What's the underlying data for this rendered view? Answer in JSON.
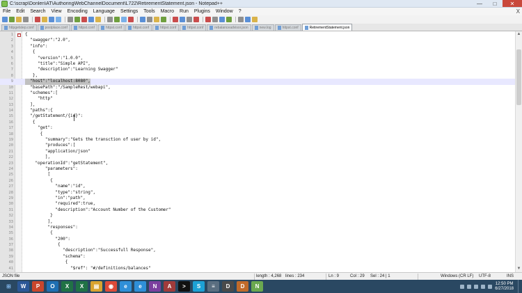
{
  "window": {
    "title": "C:\\scrap\\Donlen\\AT\\AuthoringWebChannelDocument\\L722\\RetirementStatement.json - Notepad++",
    "minimize": "—",
    "maximize": "□",
    "close": "✕"
  },
  "menu": {
    "items": [
      "File",
      "Edit",
      "Search",
      "View",
      "Encoding",
      "Language",
      "Settings",
      "Tools",
      "Macro",
      "Run",
      "Plugins",
      "Window",
      "?"
    ],
    "close_doc": "X"
  },
  "toolbar": {
    "colors": [
      "#5a8fd6",
      "#6f9f3f",
      "#d9b34a",
      "#8f8f8f",
      "#c94c4c",
      "#d9b34a",
      "#5a8fd6",
      "#7ab0e8",
      "#8f8f8f",
      "#6f9f3f",
      "#c94c4c",
      "#5a8fd6",
      "#d9b34a",
      "#8f8f8f",
      "#6f9f3f",
      "#7ab0e8",
      "#c94c4c",
      "#5a8fd6",
      "#8f8f8f",
      "#d9b34a",
      "#6f9f3f",
      "#c94c4c",
      "#5a8fd6",
      "#8f8f8f",
      "#c94c4c",
      "#c94c4c",
      "#8f8f8f",
      "#5a8fd6",
      "#6f9f3f",
      "#8f8f8f",
      "#5a8fd6",
      "#d9b34a"
    ]
  },
  "tabs": [
    {
      "label": "httpgetstep.conf"
    },
    {
      "label": "postplace.conf"
    },
    {
      "label": "httpst.conf"
    },
    {
      "label": "httpst.conf"
    },
    {
      "label": "httpst.conf"
    },
    {
      "label": "httpst.conf"
    },
    {
      "label": "httpst.conf"
    },
    {
      "label": "rebalanceadvisor.json"
    },
    {
      "label": "new.log"
    },
    {
      "label": "httpst.conf"
    },
    {
      "label": "RetirementStatement.json",
      "active": true
    }
  ],
  "editor": {
    "current_line": 9,
    "lines": [
      {
        "n": "1",
        "m": "box",
        "t": "{"
      },
      {
        "n": "2",
        "m": "",
        "t": "  \"swagger\":\"2.0\","
      },
      {
        "n": "3",
        "m": "",
        "t": "  \"info\":"
      },
      {
        "n": "4",
        "m": "",
        "t": "   {"
      },
      {
        "n": "5",
        "m": "",
        "t": "     \"version\":\"1.0.0\","
      },
      {
        "n": "6",
        "m": "",
        "t": "     \"title\":\"Simple API\","
      },
      {
        "n": "7",
        "m": "",
        "t": "     \"description\":\"Learning Swagger\""
      },
      {
        "n": "8",
        "m": "",
        "t": "   },"
      },
      {
        "n": "9",
        "m": "",
        "t": "  \"host\":\"localhost:8080\",",
        "sel": true
      },
      {
        "n": "10",
        "m": "",
        "t": "  \"basePath\":\"/SampleRest/webapi\","
      },
      {
        "n": "11",
        "m": "",
        "t": "  \"schemes\":["
      },
      {
        "n": "12",
        "m": "",
        "t": "     \"http\""
      },
      {
        "n": "13",
        "m": "",
        "t": "  ],"
      },
      {
        "n": "14",
        "m": "",
        "t": "  \"paths\":{"
      },
      {
        "n": "15",
        "m": "",
        "t": "  \"/getStatement/{id}\":"
      },
      {
        "n": "16",
        "m": "",
        "t": "   {"
      },
      {
        "n": "17",
        "m": "",
        "t": "     \"get\":"
      },
      {
        "n": "18",
        "m": "",
        "t": "      {"
      },
      {
        "n": "19",
        "m": "",
        "t": "        \"summary\":\"Gets the transction of user by id\","
      },
      {
        "n": "20",
        "m": "",
        "t": "        \"produces\":["
      },
      {
        "n": "21",
        "m": "",
        "t": "        \"application/json\""
      },
      {
        "n": "22",
        "m": "",
        "t": "        ],"
      },
      {
        "n": "23",
        "m": "",
        "t": "    \"operationId\":\"getStatement\","
      },
      {
        "n": "24",
        "m": "",
        "t": "        \"parameters\":"
      },
      {
        "n": "25",
        "m": "",
        "t": "         ["
      },
      {
        "n": "26",
        "m": "",
        "t": "          {"
      },
      {
        "n": "27",
        "m": "",
        "t": "            \"name\":\"id\","
      },
      {
        "n": "28",
        "m": "",
        "t": "            \"type\":\"string\","
      },
      {
        "n": "29",
        "m": "",
        "t": "            \"in\":\"path\","
      },
      {
        "n": "30",
        "m": "",
        "t": "            \"required\":true,"
      },
      {
        "n": "31",
        "m": "",
        "t": "            \"description\":\"Account Number of the Customer\""
      },
      {
        "n": "32",
        "m": "",
        "t": "          }"
      },
      {
        "n": "33",
        "m": "",
        "t": "         ],"
      },
      {
        "n": "34",
        "m": "",
        "t": "         \"responses\":"
      },
      {
        "n": "35",
        "m": "",
        "t": "          {"
      },
      {
        "n": "36",
        "m": "",
        "t": "            \"200\":"
      },
      {
        "n": "37",
        "m": "",
        "t": "             {"
      },
      {
        "n": "38",
        "m": "",
        "t": "               \"description\":\"Successfull Response\","
      },
      {
        "n": "39",
        "m": "",
        "t": "               \"schema\":"
      },
      {
        "n": "40",
        "m": "",
        "t": "                {"
      },
      {
        "n": "41",
        "m": "",
        "t": "                  \"$ref\": \"#/definitions/balances\""
      }
    ]
  },
  "status": {
    "file_type": "JSON file",
    "length": "length : 4,268",
    "lines": "lines : 234",
    "position": "Ln : 9",
    "column": "Col : 29",
    "selection": "Sel : 24 | 1",
    "eol": "Windows (CR LF)",
    "encoding": "UTF-8",
    "mode": "INS"
  },
  "taskbar": {
    "apps": [
      {
        "name": "word",
        "glyph": "W",
        "color": "#2b5797"
      },
      {
        "name": "powerpoint",
        "glyph": "P",
        "color": "#c8462c"
      },
      {
        "name": "outlook",
        "glyph": "O",
        "color": "#1f6fb2"
      },
      {
        "name": "excel",
        "glyph": "X",
        "color": "#207245"
      },
      {
        "name": "excel-2",
        "glyph": "X",
        "color": "#207245"
      },
      {
        "name": "explorer",
        "glyph": "▤",
        "color": "#d8a32f"
      },
      {
        "name": "chrome",
        "glyph": "◉",
        "color": "#dd4b39"
      },
      {
        "name": "ie",
        "glyph": "e",
        "color": "#2f8fd8"
      },
      {
        "name": "ie-2",
        "glyph": "e",
        "color": "#2f8fd8"
      },
      {
        "name": "onenote",
        "glyph": "N",
        "color": "#7b3f9e"
      },
      {
        "name": "access",
        "glyph": "A",
        "color": "#a03b3b"
      },
      {
        "name": "cmd",
        "glyph": ">",
        "color": "#111111"
      },
      {
        "name": "skype",
        "glyph": "S",
        "color": "#1da1d6"
      },
      {
        "name": "tool-1",
        "glyph": "≡",
        "color": "#5a6e80"
      },
      {
        "name": "tool-2",
        "glyph": "D",
        "color": "#4a4a4a"
      },
      {
        "name": "tool-3",
        "glyph": "D",
        "color": "#c06a2a"
      },
      {
        "name": "notepadpp",
        "glyph": "N",
        "color": "#6aa84f"
      }
    ],
    "time": "12:50 PM",
    "date": "6/27/2018"
  }
}
